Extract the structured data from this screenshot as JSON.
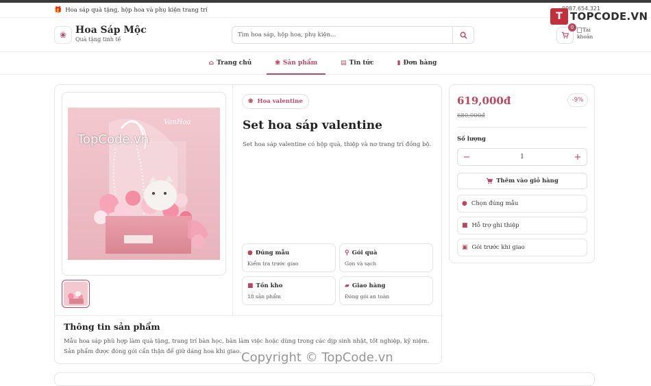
{
  "promo": {
    "icon": "gift-icon",
    "text": "Hoa sáp quà tặng, hộp hoa và phụ kiện trang trí"
  },
  "hotline": "0987.654.321",
  "watermark": {
    "brand": "TOPCODE.VN",
    "logo_letter": "T",
    "image_text": "TopCode.vn",
    "copyright": "Copyright © TopCode.vn"
  },
  "header": {
    "logo_icon": "lotus-icon",
    "brand_name": "Hoa Sáp Mộc",
    "tagline": "Quà tặng tinh tế",
    "search_placeholder": "Tìm hoa sáp, hộp hoa, phụ kiện...",
    "cart_count": "0",
    "account_alt": "Tài khoản"
  },
  "nav": [
    {
      "label": "Trang chủ",
      "icon": "home-icon",
      "active": false
    },
    {
      "label": "Sản phẩm",
      "icon": "lotus-icon",
      "active": true
    },
    {
      "label": "Tin tức",
      "icon": "newspaper-icon",
      "active": false
    },
    {
      "label": "Đơn hàng",
      "icon": "receipt-icon",
      "active": false
    }
  ],
  "product": {
    "category": "Hoa valentine",
    "title": "Set hoa sáp valentine",
    "short_desc": "Set hoa sáp valentine có hộp quà, thiệp và nơ trang trí đồng bộ.",
    "image_box_brand": "VanHoa",
    "features": [
      {
        "title": "Đúng mẫu",
        "sub": "Kiểm tra trước giao",
        "icon": "check-circle-icon"
      },
      {
        "title": "Gói quà",
        "sub": "Gọn và sạch",
        "icon": "ribbon-icon"
      },
      {
        "title": "Tồn kho",
        "sub": "18 sản phẩm",
        "icon": "box-icon"
      },
      {
        "title": "Giao hàng",
        "sub": "Đóng gói an toàn",
        "icon": "truck-icon"
      }
    ],
    "info_title": "Thông tin sản phẩm",
    "info_body": "Mẫu hoa sáp phù hợp làm quà tặng, trang trí bàn học, bàn làm việc hoặc dùng trong các dịp sinh nhật, tốt nghiệp, kỷ niệm. Sản phẩm được đóng gói cẩn thận để giữ dáng hoa khi giao."
  },
  "buy": {
    "price": "619,000đ",
    "discount": "-9%",
    "old_price": "680,000đ",
    "qty_label": "Số lượng",
    "qty_value": "1",
    "minus": "−",
    "plus": "+",
    "add_to_cart": "Thêm vào giỏ hàng",
    "perks": [
      {
        "label": "Chọn đúng mẫu",
        "icon": "check-circle-icon"
      },
      {
        "label": "Hỗ trợ ghi thiệp",
        "icon": "message-icon"
      },
      {
        "label": "Gói trước khi giao",
        "icon": "gift-icon"
      }
    ]
  },
  "colors": {
    "accent": "#b44a5f",
    "border": "#e5e5e5",
    "text": "#2b2b2b"
  }
}
